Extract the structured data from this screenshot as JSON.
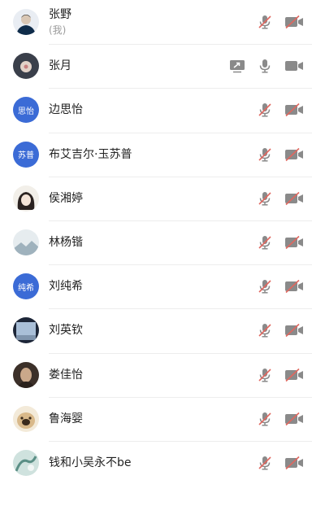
{
  "participants": [
    {
      "name": "张野",
      "sub": "(我)",
      "avatar": {
        "type": "photo",
        "icon": "avatar-suit-man",
        "colors": [
          "#0f2c4a",
          "#d9c7b5"
        ]
      },
      "mic": "muted",
      "cam": "off",
      "share": false
    },
    {
      "name": "张月",
      "sub": "",
      "avatar": {
        "type": "photo",
        "icon": "avatar-flower",
        "colors": [
          "#3a3f4a",
          "#e2d2c8"
        ]
      },
      "mic": "on",
      "cam": "on",
      "share": true
    },
    {
      "name": "边思怡",
      "sub": "",
      "avatar": {
        "type": "text",
        "label": "思怡",
        "color": "#3b6bd6"
      },
      "mic": "muted",
      "cam": "off",
      "share": false
    },
    {
      "name": "布艾吉尔·玉苏普",
      "sub": "",
      "avatar": {
        "type": "text",
        "label": "苏普",
        "color": "#3b6bd6"
      },
      "mic": "muted",
      "cam": "off",
      "share": false
    },
    {
      "name": "侯湘婷",
      "sub": "",
      "avatar": {
        "type": "photo",
        "icon": "avatar-anime-girl",
        "colors": [
          "#f2efe9",
          "#2a2220"
        ]
      },
      "mic": "muted",
      "cam": "off",
      "share": false
    },
    {
      "name": "林杨锴",
      "sub": "",
      "avatar": {
        "type": "photo",
        "icon": "avatar-landscape",
        "colors": [
          "#e6ecef",
          "#9fb2bd"
        ]
      },
      "mic": "muted",
      "cam": "off",
      "share": false
    },
    {
      "name": "刘纯希",
      "sub": "",
      "avatar": {
        "type": "text",
        "label": "纯希",
        "color": "#3b6bd6"
      },
      "mic": "muted",
      "cam": "off",
      "share": false
    },
    {
      "name": "刘英钦",
      "sub": "",
      "avatar": {
        "type": "photo",
        "icon": "avatar-blue-sky",
        "colors": [
          "#1d2638",
          "#a9bfd8"
        ]
      },
      "mic": "muted",
      "cam": "off",
      "share": false
    },
    {
      "name": "娄佳怡",
      "sub": "",
      "avatar": {
        "type": "photo",
        "icon": "avatar-woman",
        "colors": [
          "#3c3029",
          "#caa88a"
        ]
      },
      "mic": "muted",
      "cam": "off",
      "share": false
    },
    {
      "name": "鲁海婴",
      "sub": "",
      "avatar": {
        "type": "photo",
        "icon": "avatar-puppy",
        "colors": [
          "#d9b98a",
          "#3a2a1c"
        ]
      },
      "mic": "muted",
      "cam": "off",
      "share": false
    },
    {
      "name": "钱和小吴永不be",
      "sub": "",
      "avatar": {
        "type": "photo",
        "icon": "avatar-teal-drawing",
        "colors": [
          "#cfe2de",
          "#5b8f86"
        ]
      },
      "mic": "muted",
      "cam": "off",
      "share": false
    }
  ],
  "colors": {
    "icon_gray": "#8a8a8a",
    "mute_red": "#e0675f",
    "separator": "#ededed"
  }
}
